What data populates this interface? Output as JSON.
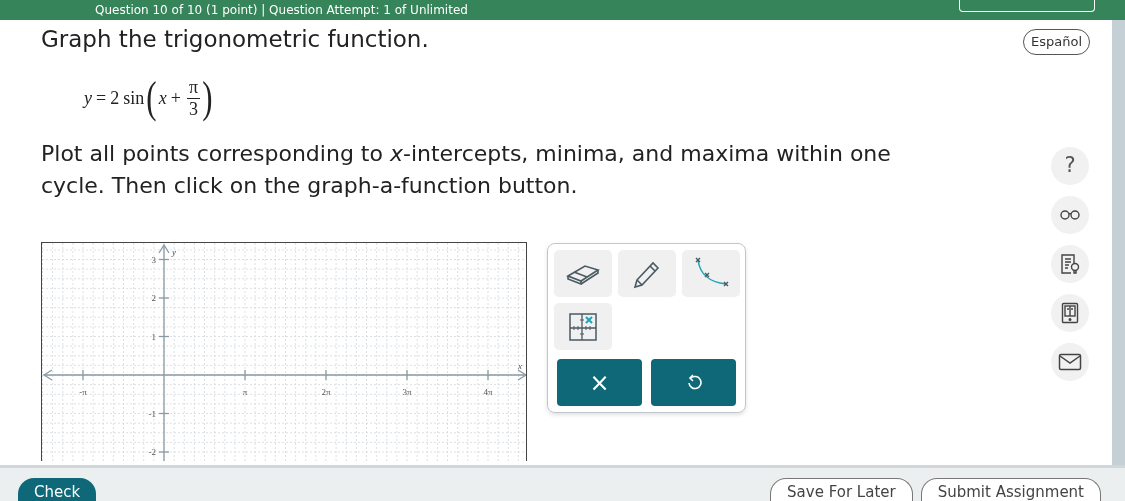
{
  "header": {
    "text": "Question 10 of 10 (1 point)  |  Question Attempt: 1 of Unlimited"
  },
  "title": "Graph the trigonometric function.",
  "language_button": "Español",
  "equation": {
    "lhs": "y",
    "equals": "=",
    "coefficient": "2",
    "function": "sin",
    "open": "(",
    "variable": "x",
    "plus": "+",
    "numerator": "π",
    "denominator": "3",
    "close": ")"
  },
  "instruction": "Plot all points corresponding to *x*-intercepts, minima, and maxima within one cycle. Then click on the graph-a-function button.",
  "graph": {
    "x_axis_label": "x",
    "y_axis_label": "y",
    "x_ticks": [
      "-π",
      "π",
      "2π",
      "3π",
      "4π"
    ],
    "y_ticks": [
      "3",
      "2",
      "1",
      "-1",
      "-2"
    ]
  },
  "tools": [
    {
      "kind": "eraser"
    },
    {
      "kind": "pencil"
    },
    {
      "kind": "curve"
    },
    {
      "kind": "point"
    }
  ],
  "actions": [
    {
      "kind": "clear",
      "label": "×"
    },
    {
      "kind": "undo"
    }
  ],
  "side_tools": [
    {
      "kind": "help",
      "label": "?"
    },
    {
      "kind": "glasses"
    },
    {
      "kind": "hint"
    },
    {
      "kind": "ebook"
    },
    {
      "kind": "mail"
    }
  ],
  "footer": {
    "check": "Check",
    "save": "Save For Later",
    "submit": "Submit Assignment"
  }
}
